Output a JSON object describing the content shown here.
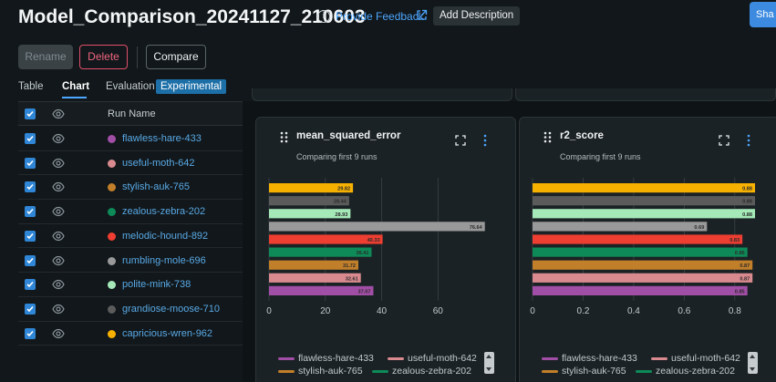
{
  "header": {
    "title": "Model_Comparison_20241127_210603",
    "feedback_label": "Provide Feedback",
    "add_description_label": "Add Description",
    "share_label": "Sha"
  },
  "toolbar": {
    "rename_label": "Rename",
    "delete_label": "Delete",
    "compare_label": "Compare"
  },
  "tabs": {
    "table_label": "Table",
    "chart_label": "Chart",
    "evaluation_label": "Evaluation",
    "experimental_badge": "Experimental"
  },
  "runs_table": {
    "header_label": "Run Name",
    "runs": [
      {
        "name": "flawless-hare-433",
        "color": "#a14ea6"
      },
      {
        "name": "useful-moth-642",
        "color": "#d88a8f"
      },
      {
        "name": "stylish-auk-765",
        "color": "#c17f2a"
      },
      {
        "name": "zealous-zebra-202",
        "color": "#0d8a58"
      },
      {
        "name": "melodic-hound-892",
        "color": "#ee3e31"
      },
      {
        "name": "rumbling-mole-696",
        "color": "#999999"
      },
      {
        "name": "polite-mink-738",
        "color": "#a5e9b8"
      },
      {
        "name": "grandiose-moose-710",
        "color": "#5b5b5b"
      },
      {
        "name": "capricious-wren-962",
        "color": "#f6b000"
      }
    ]
  },
  "charts": {
    "mse": {
      "title": "mean_squared_error",
      "subtitle": "Comparing first 9 runs"
    },
    "r2": {
      "title": "r2_score",
      "subtitle": "Comparing first 9 runs"
    }
  },
  "chart_data": [
    {
      "type": "bar",
      "orientation": "horizontal",
      "title": "mean_squared_error",
      "subtitle": "Comparing first 9 runs",
      "categories": [
        "capricious-wren-962",
        "grandiose-moose-710",
        "polite-mink-738",
        "rumbling-mole-696",
        "melodic-hound-892",
        "zealous-zebra-202",
        "stylish-auk-765",
        "useful-moth-642",
        "flawless-hare-433"
      ],
      "values": [
        29.82,
        28.44,
        28.93,
        76.64,
        40.33,
        36.41,
        31.72,
        32.61,
        37.07
      ],
      "labels": [
        "29.82",
        "28.44",
        "28.93",
        "76.64",
        "40.33",
        "36.41",
        "31.72",
        "32.61",
        "37.07"
      ],
      "colors": [
        "#f6b000",
        "#5b5b5b",
        "#a5e9b8",
        "#999999",
        "#ee3e31",
        "#0d8a58",
        "#c17f2a",
        "#d88a8f",
        "#a14ea6"
      ],
      "xticks": [
        "0",
        "20",
        "40",
        "60"
      ],
      "xlim": [
        0,
        79
      ],
      "grid": true,
      "legend": "bottom"
    },
    {
      "type": "bar",
      "orientation": "horizontal",
      "title": "r2_score",
      "subtitle": "Comparing first 9 runs",
      "categories": [
        "capricious-wren-962",
        "grandiose-moose-710",
        "polite-mink-738",
        "rumbling-mole-696",
        "melodic-hound-892",
        "zealous-zebra-202",
        "stylish-auk-765",
        "useful-moth-642",
        "flawless-hare-433"
      ],
      "values": [
        0.88,
        0.88,
        0.88,
        0.69,
        0.83,
        0.85,
        0.87,
        0.87,
        0.85
      ],
      "labels": [
        "0.88",
        "0.88",
        "0.88",
        "0.69",
        "0.83",
        "0.85",
        "0.87",
        "0.87",
        "0.85"
      ],
      "colors": [
        "#f6b000",
        "#5b5b5b",
        "#a5e9b8",
        "#999999",
        "#ee3e31",
        "#0d8a58",
        "#c17f2a",
        "#d88a8f",
        "#a14ea6"
      ],
      "xticks": [
        "0",
        "0.2",
        "0.4",
        "0.6",
        "0.8"
      ],
      "xlim": [
        0,
        0.88
      ],
      "grid": true,
      "legend": "bottom"
    }
  ],
  "legend": {
    "items": [
      {
        "name": "flawless-hare-433",
        "color": "#a14ea6"
      },
      {
        "name": "useful-moth-642",
        "color": "#d88a8f"
      },
      {
        "name": "stylish-auk-765",
        "color": "#c17f2a"
      },
      {
        "name": "zealous-zebra-202",
        "color": "#0d8a58"
      }
    ]
  },
  "icons": {
    "info": "info-icon",
    "external_link": "external-link-icon",
    "checkbox": "checkbox-checked-icon",
    "eye": "eye-icon",
    "drag": "drag-handle-icon",
    "expand": "expand-icon",
    "kebab": "kebab-menu-icon"
  }
}
